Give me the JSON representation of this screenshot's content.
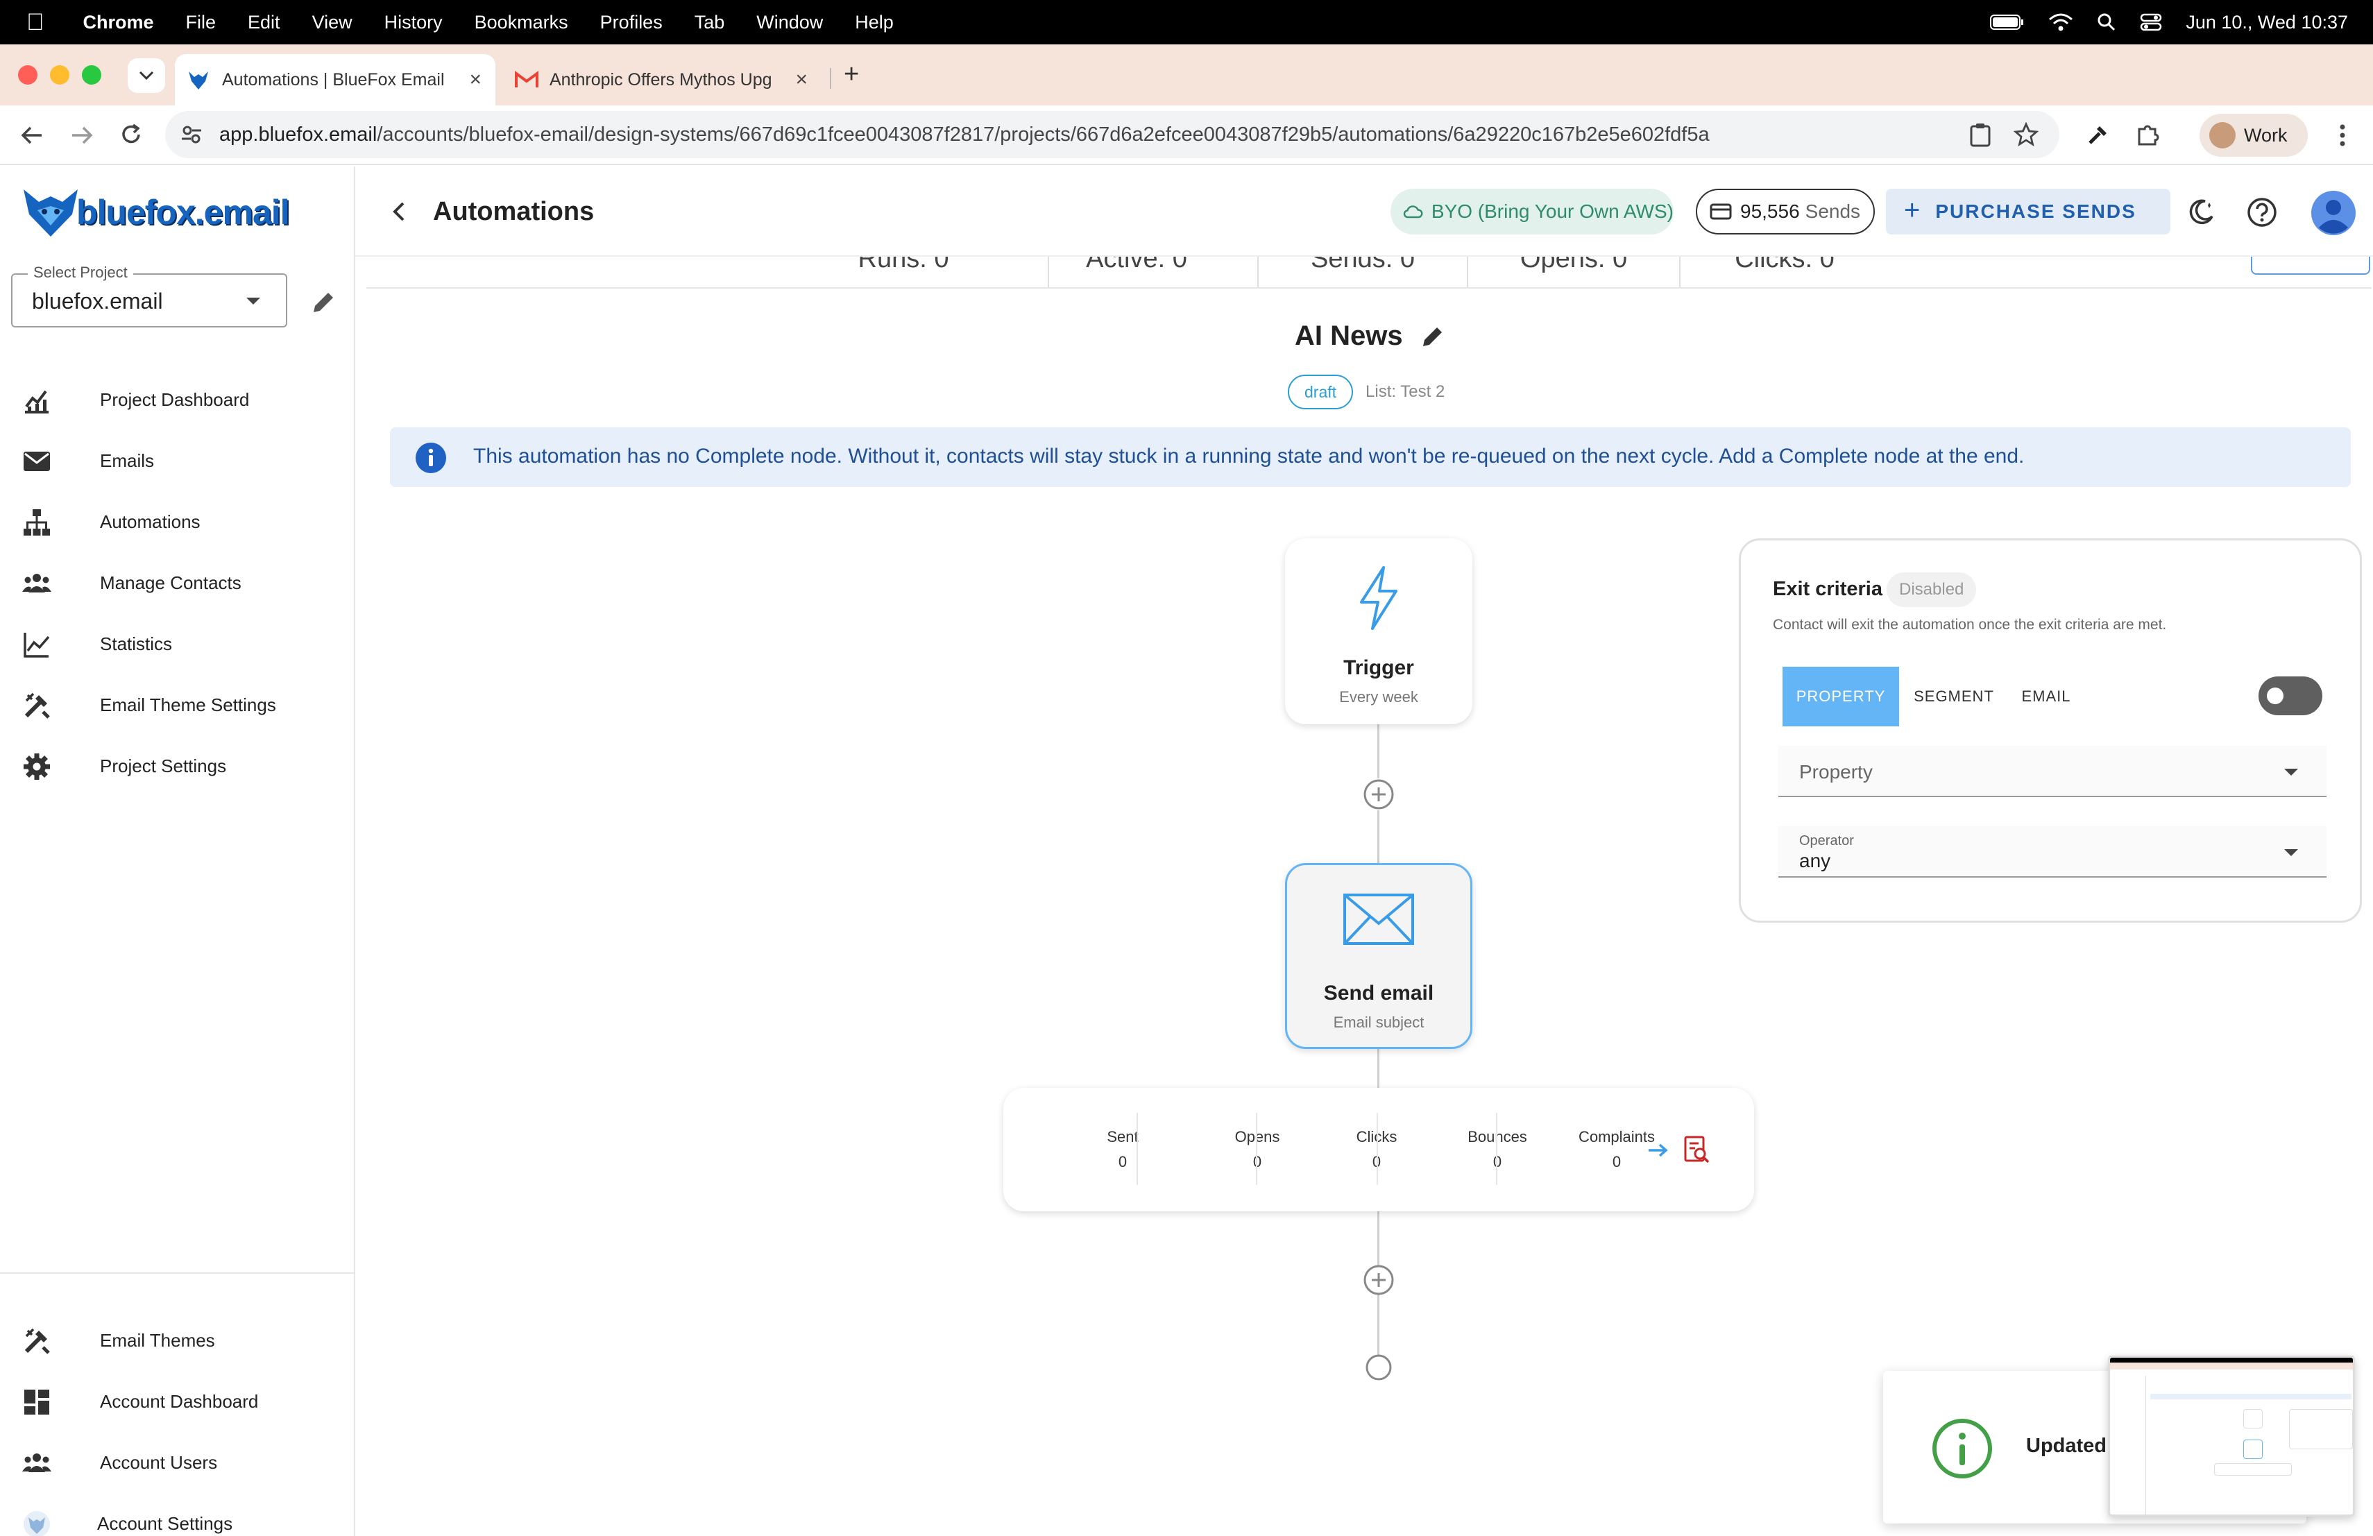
{
  "menubar": {
    "app": "Chrome",
    "items": [
      "File",
      "Edit",
      "View",
      "History",
      "Bookmarks",
      "Profiles",
      "Tab",
      "Window",
      "Help"
    ],
    "datetime": "Jun 10., Wed 10:37"
  },
  "browser": {
    "tabs": [
      {
        "title": "Automations | BlueFox Email"
      },
      {
        "title": "Anthropic Offers Mythos Upg"
      }
    ],
    "url_host": "app.bluefox.email",
    "url_path": "/accounts/bluefox-email/design-systems/667d69c1fcee0043087f2817/projects/667d6a2efcee0043087f29b5/automations/6a29220c167b2e5e602fdf5a",
    "profile": "Work"
  },
  "sidebar": {
    "logo": "bluefox.email",
    "project_select": {
      "label": "Select Project",
      "value": "bluefox.email"
    },
    "items": [
      {
        "label": "Project Dashboard",
        "icon": "dashboard-chart-icon"
      },
      {
        "label": "Emails",
        "icon": "mail-icon"
      },
      {
        "label": "Automations",
        "icon": "sitemap-icon"
      },
      {
        "label": "Manage Contacts",
        "icon": "people-icon"
      },
      {
        "label": "Statistics",
        "icon": "line-chart-icon"
      },
      {
        "label": "Email Theme Settings",
        "icon": "tools-icon"
      },
      {
        "label": "Project Settings",
        "icon": "gear-icon"
      }
    ],
    "bottom_items": [
      {
        "label": "Email Themes",
        "icon": "tools-icon"
      },
      {
        "label": "Account Dashboard",
        "icon": "grid-icon"
      },
      {
        "label": "Account Users",
        "icon": "people-icon"
      },
      {
        "label": "Account Settings",
        "icon": "fox-avatar-icon"
      }
    ]
  },
  "header": {
    "title": "Automations",
    "byo": "BYO (Bring Your Own AWS)",
    "sends_count": "95,556",
    "sends_label": "Sends",
    "purchase_label": "PURCHASE SENDS"
  },
  "stats_strip": [
    "Runs: 0",
    "Active: 0",
    "Sends: 0",
    "Opens: 0",
    "Clicks: 0"
  ],
  "automation": {
    "name": "AI News",
    "status": "draft",
    "list": "List: Test 2"
  },
  "alert": {
    "text": "This automation has no Complete node. Without it, contacts will stay stuck in a running state and won't be re-queued on the next cycle. Add a Complete node at the end."
  },
  "nodes": {
    "trigger": {
      "title": "Trigger",
      "subtitle": "Every week"
    },
    "send_email": {
      "title": "Send email",
      "subtitle": "Email subject"
    }
  },
  "metrics": [
    {
      "label": "Sent",
      "value": "0"
    },
    {
      "label": "Opens",
      "value": "0"
    },
    {
      "label": "Clicks",
      "value": "0"
    },
    {
      "label": "Bounces",
      "value": "0"
    },
    {
      "label": "Complaints",
      "value": "0"
    }
  ],
  "exit_criteria": {
    "title": "Exit criteria",
    "badge": "Disabled",
    "description": "Contact will exit the automation once the exit criteria are met.",
    "tabs": [
      "PROPERTY",
      "SEGMENT",
      "EMAIL"
    ],
    "property_placeholder": "Property",
    "operator_label": "Operator",
    "operator_value": "any"
  },
  "toast": {
    "text": "Updated"
  },
  "colors": {
    "brand_blue": "#1565c0",
    "accent": "#2196f3",
    "alert_bg": "#e6effa",
    "tab_active": "#64b5f6",
    "toast_green": "#43a047",
    "byo_bg": "#e3f1ec"
  }
}
